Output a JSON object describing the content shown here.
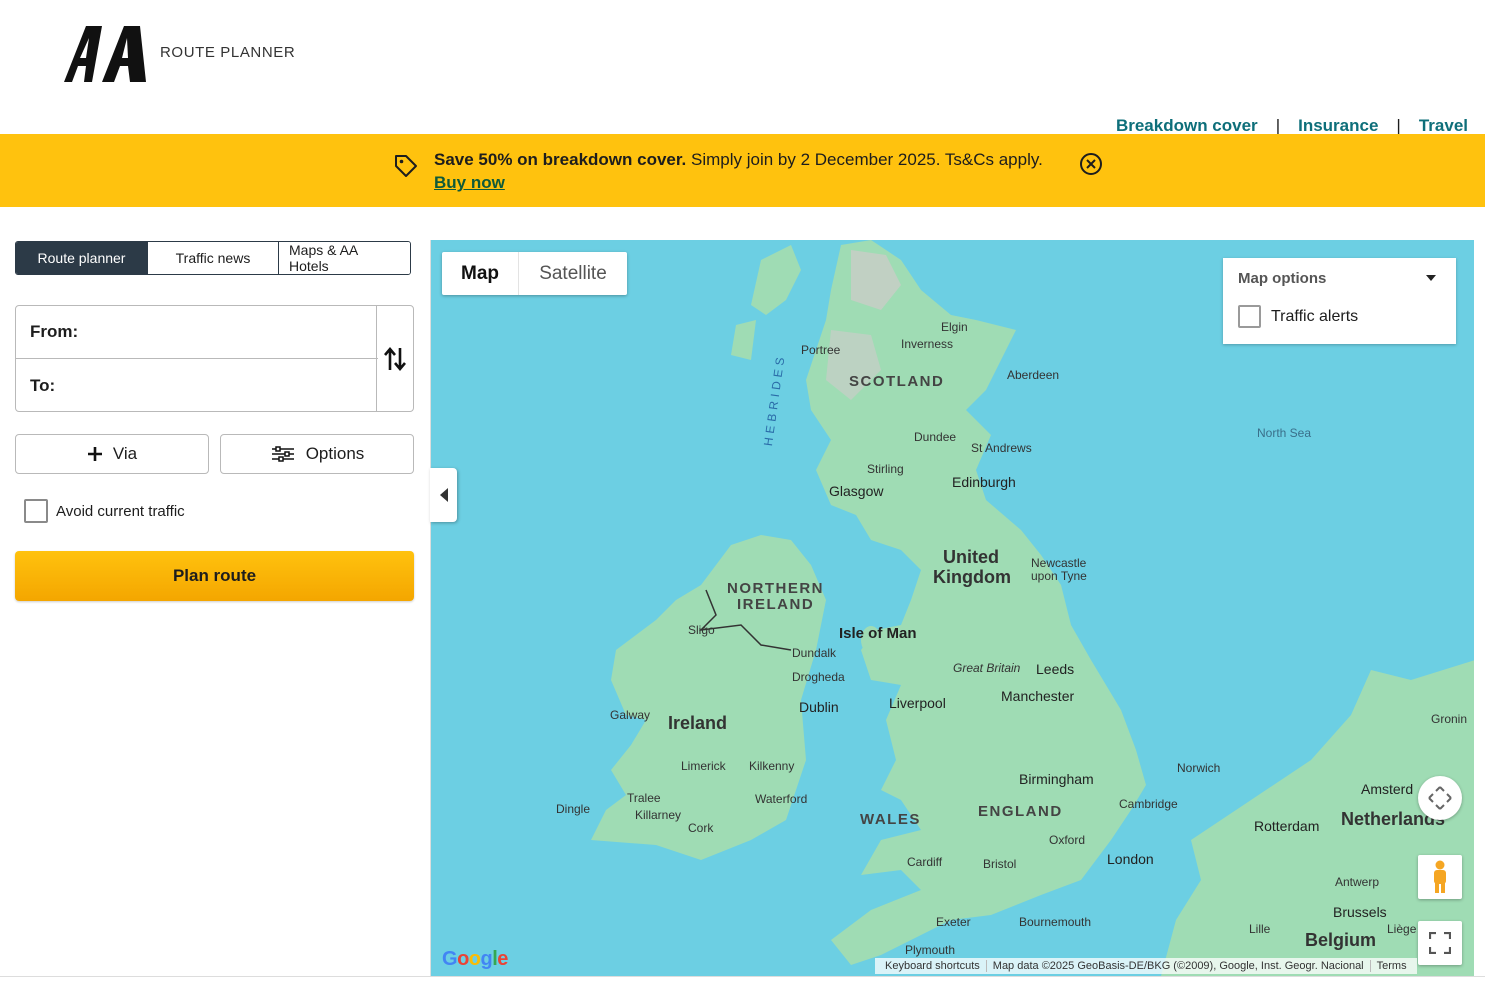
{
  "header": {
    "logo_text": "AA",
    "subtitle": "ROUTE PLANNER",
    "nav": [
      "Breakdown cover",
      "Insurance",
      "Travel"
    ]
  },
  "banner": {
    "bold": "Save 50% on breakdown cover.",
    "text": " Simply join by 2 December 2025. Ts&Cs apply.",
    "link": "Buy now"
  },
  "tabs": [
    "Route planner",
    "Traffic news",
    "Maps & AA Hotels"
  ],
  "route": {
    "from_label": "From:",
    "to_label": "To:",
    "from_value": "",
    "to_value": ""
  },
  "buttons": {
    "via": "Via",
    "options": "Options",
    "plan": "Plan route"
  },
  "avoid_traffic": "Avoid current traffic",
  "map": {
    "type_map": "Map",
    "type_satellite": "Satellite",
    "options_title": "Map options",
    "traffic_alerts": "Traffic alerts",
    "google": "Google",
    "attribution": [
      "Keyboard shortcuts",
      "Map data ©2025 GeoBasis-DE/BKG (©2009), Google, Inst. Geogr. Nacional",
      "Terms"
    ],
    "labels": {
      "scotland": "SCOTLAND",
      "northern_ireland_1": "NORTHERN",
      "northern_ireland_2": "IRELAND",
      "wales": "WALES",
      "england": "ENGLAND",
      "uk1": "United",
      "uk2": "Kingdom",
      "ireland": "Ireland",
      "isle_of_man": "Isle of Man",
      "great_britain": "Great Britain",
      "hebrides": "HEBRIDES",
      "north_sea": "North Sea",
      "netherlands": "Netherlands",
      "belgium": "Belgium",
      "elgin": "Elgin",
      "inverness": "Inverness",
      "portree": "Portree",
      "aberdeen": "Aberdeen",
      "dundee": "Dundee",
      "st_andrews": "St Andrews",
      "stirling": "Stirling",
      "glasgow": "Glasgow",
      "edinburgh": "Edinburgh",
      "newcastle1": "Newcastle",
      "newcastle2": "upon Tyne",
      "sligo": "Sligo",
      "dundalk": "Dundalk",
      "drogheda": "Drogheda",
      "dublin": "Dublin",
      "galway": "Galway",
      "leeds": "Leeds",
      "liverpool": "Liverpool",
      "manchester": "Manchester",
      "limerick": "Limerick",
      "kilkenny": "Kilkenny",
      "birmingham": "Birmingham",
      "norwich": "Norwich",
      "tralee": "Tralee",
      "waterford": "Waterford",
      "dingle": "Dingle",
      "killarney": "Killarney",
      "cork": "Cork",
      "cambridge": "Cambridge",
      "oxford": "Oxford",
      "cardiff": "Cardiff",
      "bristol": "Bristol",
      "london": "London",
      "exeter": "Exeter",
      "bournemouth": "Bournemouth",
      "plymouth": "Plymouth",
      "amsterdam": "Amsterd",
      "rotterdam": "Rotterdam",
      "antwerp": "Antwerp",
      "brussels": "Brussels",
      "lille": "Lille",
      "liege": "Liège",
      "groningen": "Gronin"
    }
  },
  "colors": {
    "banner": "#ffc20e",
    "tab_active": "#2c3a47",
    "nav_link": "#0e6f7a",
    "water": "#6ccfe3",
    "land": "#9fdcb4"
  }
}
